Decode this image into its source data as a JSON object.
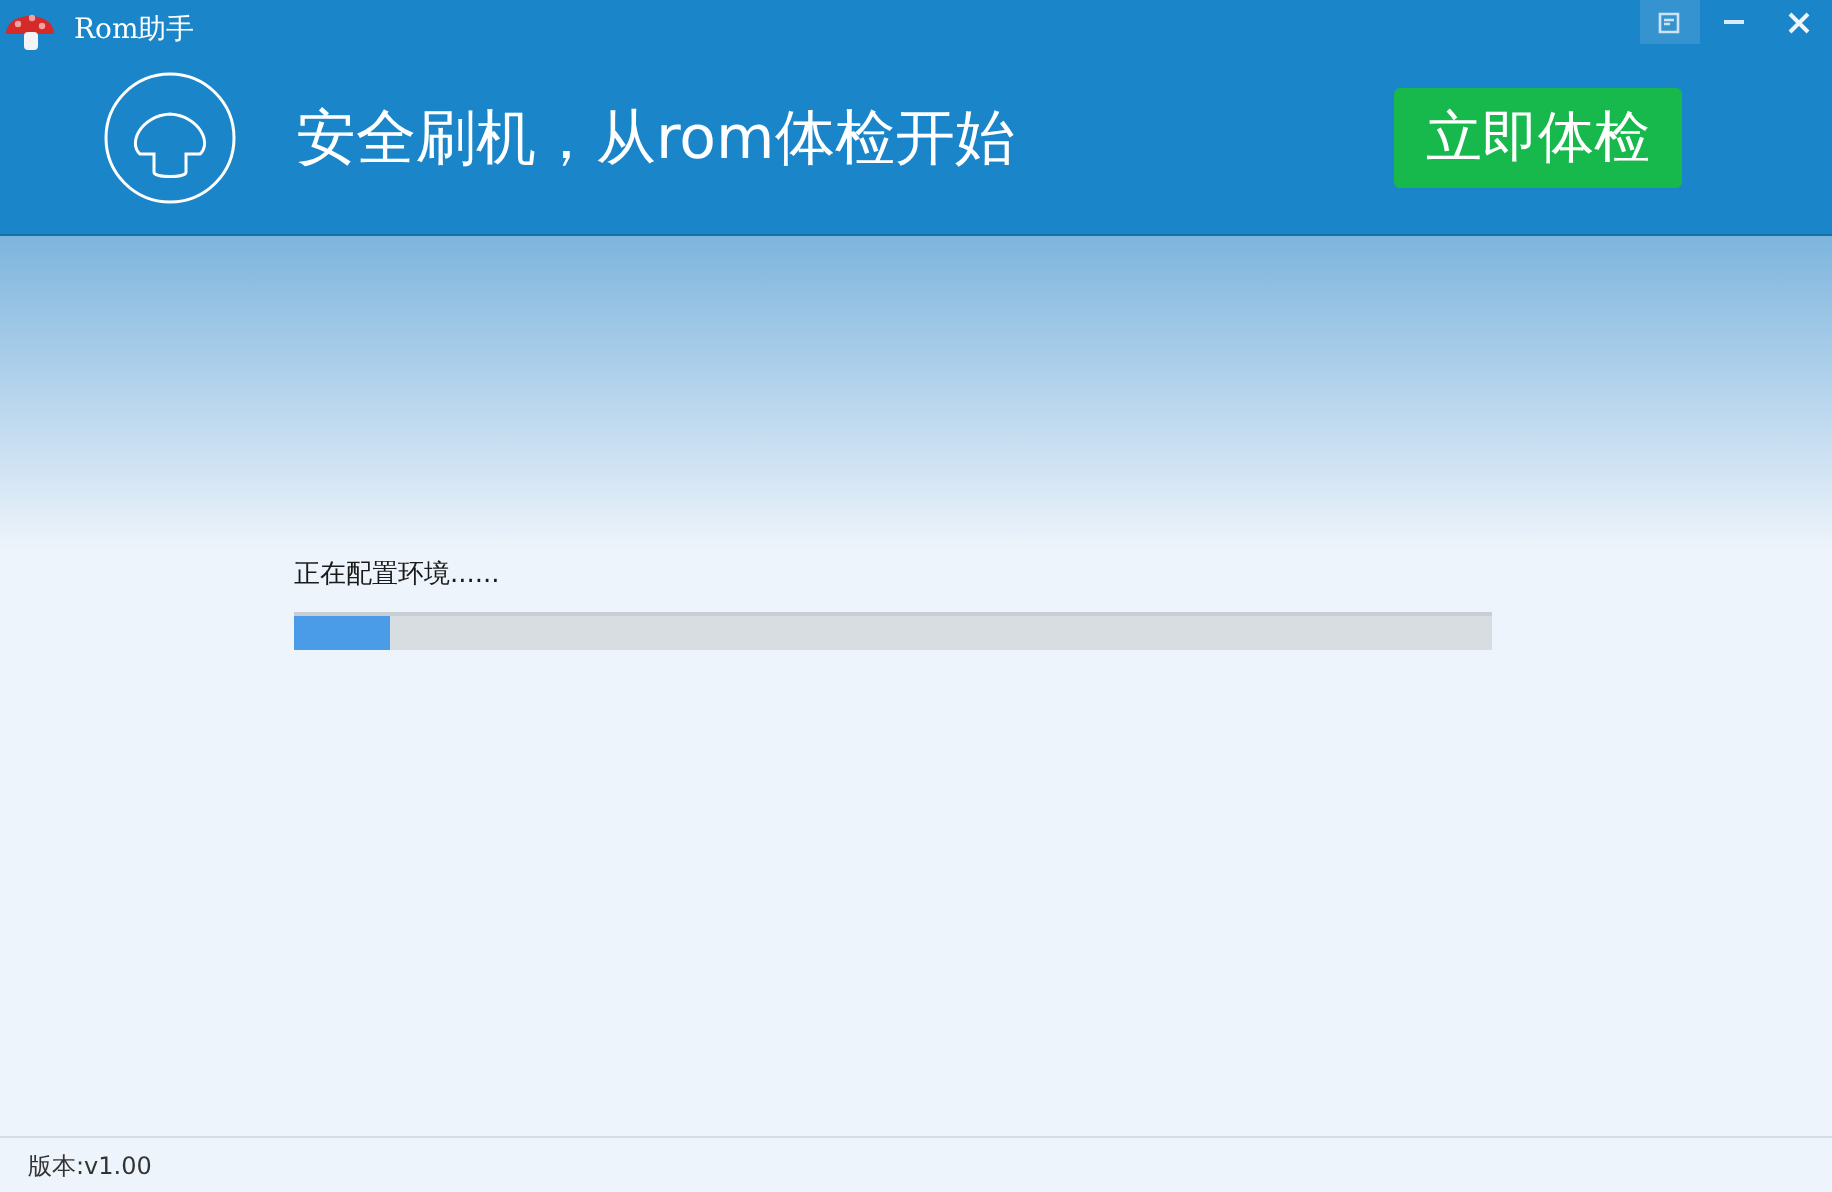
{
  "window": {
    "title": "Rom助手"
  },
  "header": {
    "slogan": "安全刷机，从rom体检开始",
    "action_button": "立即体检"
  },
  "progress": {
    "label": "正在配置环境......",
    "level": 0.08
  },
  "status_bar": {
    "version": "版本:v1.00"
  }
}
